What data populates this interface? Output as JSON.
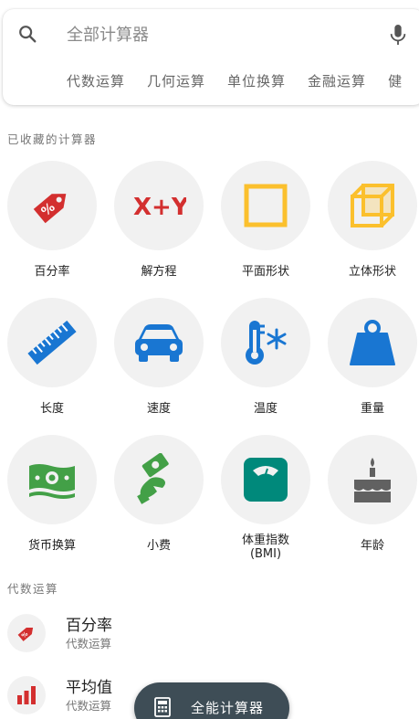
{
  "search": {
    "placeholder": "全部计算器",
    "search_icon": "search-icon",
    "mic_icon": "mic-icon"
  },
  "categories": [
    "代数运算",
    "几何运算",
    "单位换算",
    "金融运算",
    "健"
  ],
  "favorites": {
    "section_title": "已收藏的计算器",
    "items": [
      {
        "label": "百分率",
        "icon": "percent-tag-icon",
        "color": "#d32f2f"
      },
      {
        "label": "解方程",
        "icon": "x-plus-y-icon",
        "color": "#d32f2f"
      },
      {
        "label": "平面形状",
        "icon": "square-icon",
        "color": "#fbc02d"
      },
      {
        "label": "立体形状",
        "icon": "cube-icon",
        "color": "#fbc02d"
      },
      {
        "label": "长度",
        "icon": "ruler-icon",
        "color": "#1976d2"
      },
      {
        "label": "速度",
        "icon": "car-icon",
        "color": "#1976d2"
      },
      {
        "label": "温度",
        "icon": "thermometer-icon",
        "color": "#1976d2"
      },
      {
        "label": "重量",
        "icon": "weight-icon",
        "color": "#1976d2"
      },
      {
        "label": "货币换算",
        "icon": "banknote-icon",
        "color": "#43a047"
      },
      {
        "label": "小费",
        "icon": "tip-hand-icon",
        "color": "#43a047"
      },
      {
        "label": "体重指数\n(BMI)",
        "icon": "scale-icon",
        "color": "#00897b"
      },
      {
        "label": "年龄",
        "icon": "cake-icon",
        "color": "#616161"
      }
    ]
  },
  "algebra": {
    "section_title": "代数运算",
    "items": [
      {
        "title": "百分率",
        "subtitle": "代数运算",
        "icon": "percent-tag-icon"
      },
      {
        "title": "平均值",
        "subtitle": "代数运算",
        "icon": "bar-chart-icon"
      }
    ]
  },
  "fab": {
    "label": "全能计算器",
    "icon": "calculator-icon"
  }
}
